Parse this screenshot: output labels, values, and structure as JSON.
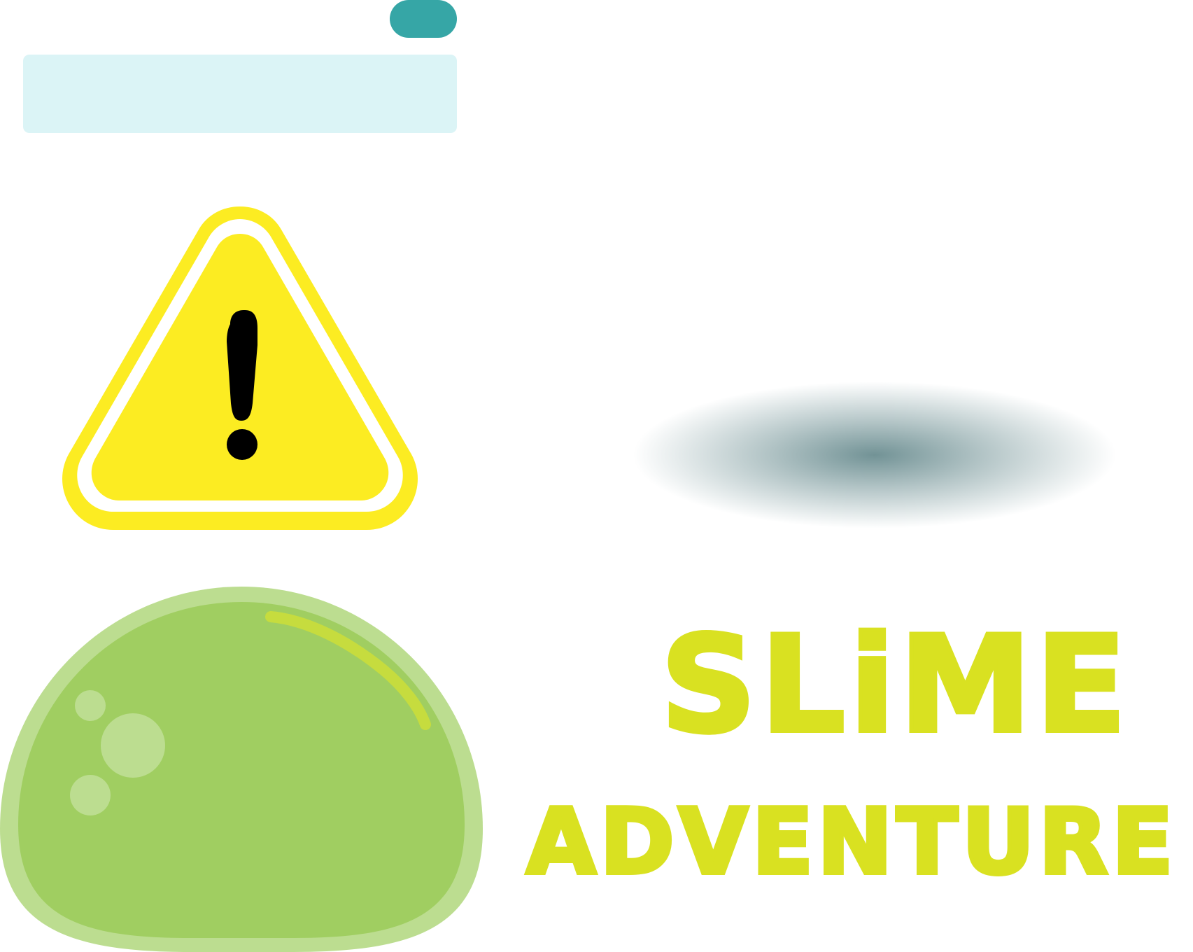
{
  "colors": {
    "button": "#36a6a6",
    "panel": "#dbf4f6",
    "warning_fill": "#fcec22",
    "warning_border": "#fcec22",
    "warning_gap": "#ffffff",
    "warning_mark": "#000000",
    "shadow": "#4a7478",
    "slime_outer": "#bcdd90",
    "slime_inner": "#a0ce61",
    "slime_bubbles": "#bcdd90",
    "slime_highlight": "#c6dc3e",
    "title": "#d9e121"
  },
  "icons": {
    "warning": "warning-icon",
    "exclamation": "exclamation-mark-icon",
    "slime": "slime-icon",
    "shadow": "drop-shadow-icon"
  },
  "title": {
    "main": "SLiME",
    "sub": "ADVENTURE"
  }
}
